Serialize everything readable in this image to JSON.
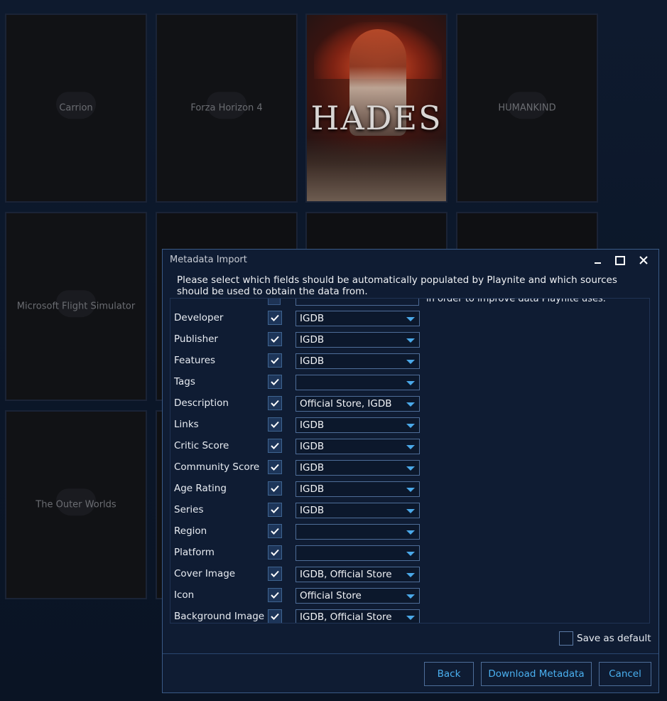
{
  "library": {
    "tiles": [
      {
        "title": "Carrion"
      },
      {
        "title": "Forza Horizon 4"
      },
      {
        "title": "HADES"
      },
      {
        "title": "HUMANKIND"
      },
      {
        "title": "Microsoft Flight Simulator"
      },
      {
        "title": "The Outer Worlds"
      }
    ]
  },
  "dialog": {
    "title": "Metadata Import",
    "window_controls": {
      "minimize": "minimize-icon",
      "maximize": "maximize-icon",
      "close": "close-icon"
    },
    "instructions": "Please select which fields should be automatically populated by Playnite and which sources should be used to obtain the data from.",
    "partial_text": "in order to improve data Playnite uses.",
    "fields": [
      {
        "label": "Developer",
        "checked": true,
        "source": "IGDB"
      },
      {
        "label": "Publisher",
        "checked": true,
        "source": "IGDB"
      },
      {
        "label": "Features",
        "checked": true,
        "source": "IGDB"
      },
      {
        "label": "Tags",
        "checked": true,
        "source": ""
      },
      {
        "label": "Description",
        "checked": true,
        "source": "Official Store, IGDB"
      },
      {
        "label": "Links",
        "checked": true,
        "source": "IGDB"
      },
      {
        "label": "Critic Score",
        "checked": true,
        "source": "IGDB"
      },
      {
        "label": "Community Score",
        "checked": true,
        "source": "IGDB"
      },
      {
        "label": "Age Rating",
        "checked": true,
        "source": "IGDB"
      },
      {
        "label": "Series",
        "checked": true,
        "source": "IGDB"
      },
      {
        "label": "Region",
        "checked": true,
        "source": ""
      },
      {
        "label": "Platform",
        "checked": true,
        "source": ""
      },
      {
        "label": "Cover Image",
        "checked": true,
        "source": "IGDB, Official Store"
      },
      {
        "label": "Icon",
        "checked": true,
        "source": "Official Store"
      },
      {
        "label": "Background Image",
        "checked": true,
        "source": "IGDB, Official Store"
      }
    ],
    "save_default_label": "Save as default",
    "save_default_checked": false,
    "buttons": {
      "back": "Back",
      "download": "Download Metadata",
      "cancel": "Cancel"
    },
    "colors": {
      "accent": "#4aa8e8",
      "dialog_bg": "#0f1c33",
      "border": "#3a5a86"
    }
  }
}
